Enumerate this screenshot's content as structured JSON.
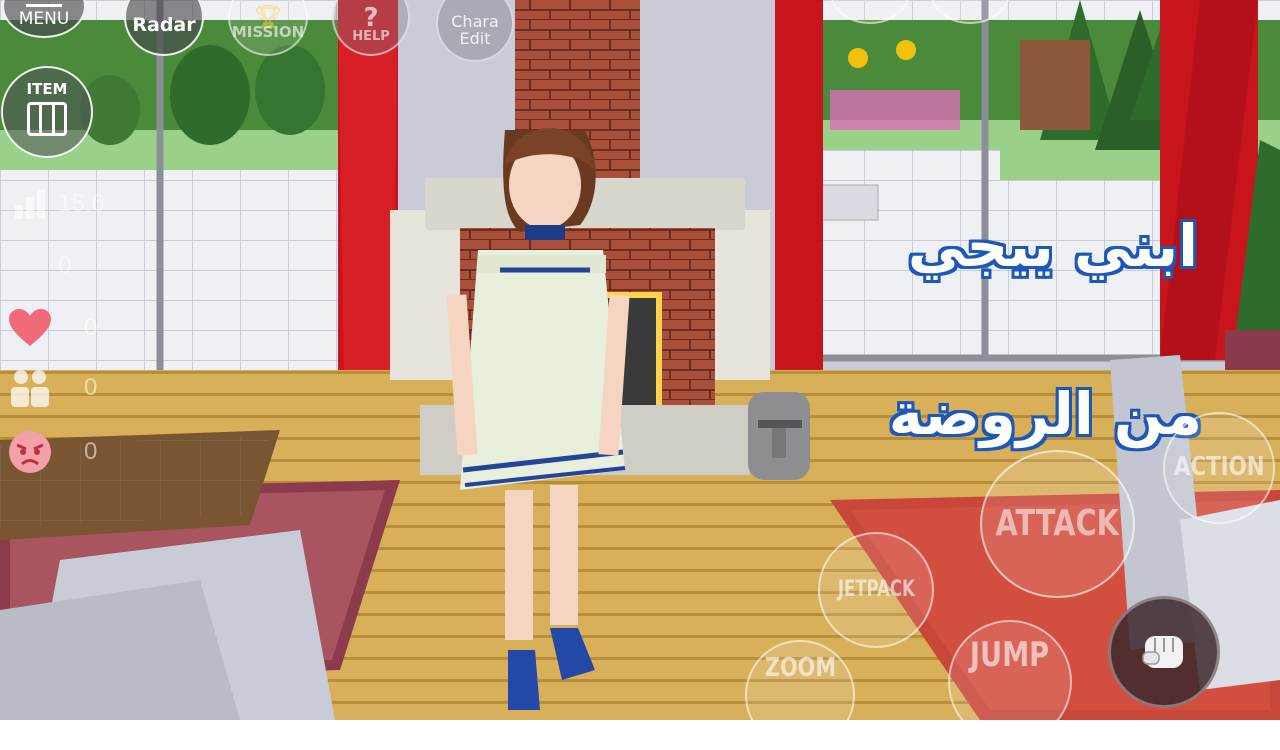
{
  "hud": {
    "menu_label": "MENU",
    "radar_label": "Radar",
    "mission_label": "MISSION",
    "help_label": "HELP",
    "chara_edit_line1": "Chara",
    "chara_edit_line2": "Edit",
    "item_label": "ITEM"
  },
  "stats": {
    "level": "15.6",
    "money": "0",
    "love": "0",
    "friends": "0",
    "anger": "0"
  },
  "actions": {
    "action": "ACTION",
    "attack": "ATTACK",
    "jetpack": "JETPACK",
    "zoom": "ZOOM",
    "jump": "JUMP"
  },
  "caption": {
    "line1": "ابني ييجي",
    "line2": "من الروضة"
  },
  "colors": {
    "caption_fill": "#ffffff",
    "caption_outline": "#1c58b8",
    "curtain": "#c8141c",
    "floor": "#d9b25a",
    "brick": "#a04634"
  }
}
